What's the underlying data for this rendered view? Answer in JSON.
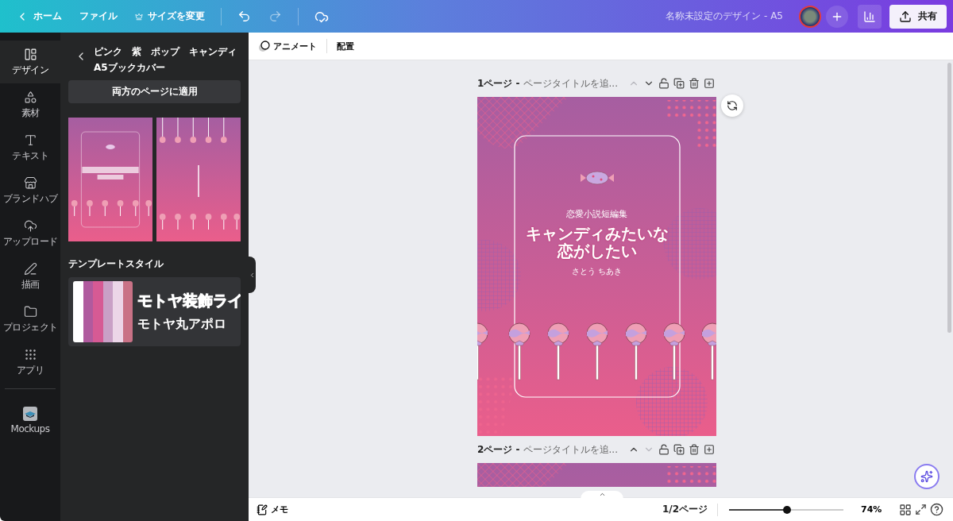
{
  "topbar": {
    "back_label": "ホーム",
    "menus": [
      {
        "label": "ファイル",
        "kind": "plain"
      },
      {
        "label": "サイズを変更",
        "kind": "premium"
      }
    ],
    "undo_disabled": false,
    "redo_disabled": true,
    "title": "名称未設定のデザイン - A5",
    "share_label": "共有"
  },
  "rail": {
    "items": [
      {
        "label": "デザイン",
        "selected": true
      },
      {
        "label": "素材",
        "selected": false
      },
      {
        "label": "テキスト",
        "selected": false
      },
      {
        "label": "ブランドハブ",
        "selected": false
      },
      {
        "label": "アップロード",
        "selected": false
      },
      {
        "label": "描画",
        "selected": false
      },
      {
        "label": "プロジェクト",
        "selected": false
      },
      {
        "label": "アプリ",
        "selected": false
      }
    ],
    "apps": [
      {
        "label": "Mockups"
      }
    ]
  },
  "panel": {
    "title_lines": [
      "ピンク　紫　ポップ　キャンディ",
      "A5ブックカバー"
    ],
    "apply_button": "両方のページに適用",
    "thumbnails": [
      {
        "kind": "cover"
      },
      {
        "kind": "back"
      }
    ],
    "section_title": "テンプレートスタイル",
    "style": {
      "swatches": [
        {
          "color": "#ffffff"
        },
        {
          "color": "#b05a9e"
        },
        {
          "color": "#d65a94"
        },
        {
          "color": "#c9a0c6"
        },
        {
          "color": "#ecd6e8"
        },
        {
          "color": "#c97286"
        }
      ],
      "fonts": [
        {
          "text": "モトヤ装飾ライ",
          "kind": "outlined"
        },
        {
          "text": "モトヤ丸アポロ",
          "kind": "plain"
        }
      ]
    }
  },
  "toolbar": [
    {
      "label": "アニメート",
      "kind": "animate"
    },
    {
      "label": "配置",
      "kind": "plain"
    }
  ],
  "pages": [
    {
      "label": "1ページ -",
      "title_placeholder": "ページタイトルを追...",
      "up_disabled": true,
      "down_disabled": false,
      "design": {
        "subtitle": "恋愛小説短編集",
        "title_lines": [
          "キャンディみたいな",
          "恋がしたい"
        ],
        "author": "さとう ちあき"
      }
    },
    {
      "label": "2ページ -",
      "title_placeholder": "ページタイトルを追...",
      "up_disabled": false,
      "down_disabled": true
    }
  ],
  "bottombar": {
    "notes_label": "メモ",
    "page_count": "1/2ページ",
    "zoom": {
      "level": 0.51
    },
    "zoom_reading": "74%"
  }
}
